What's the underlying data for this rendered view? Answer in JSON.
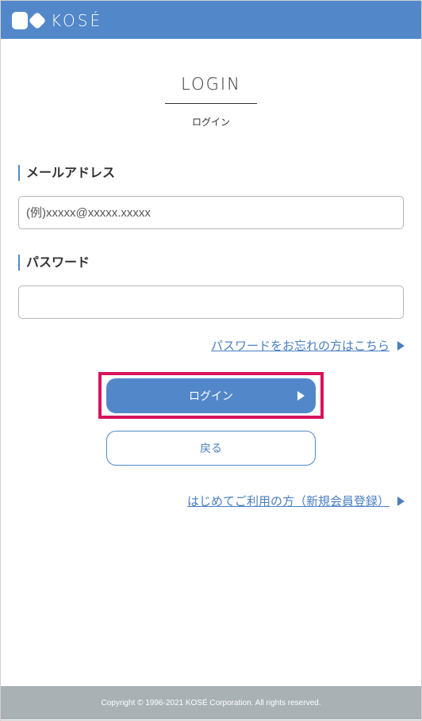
{
  "header": {
    "logo_text": "KOSÉ",
    "logo_mark_icon": "kose-logo-mark-icon",
    "bg_color": "#5288c9"
  },
  "page": {
    "title": "LOGIN",
    "subtitle": "ログイン"
  },
  "form": {
    "email_label": "メールアドレス",
    "email_placeholder": "(例)xxxxx@xxxxx.xxxxx",
    "email_value": "",
    "password_label": "パスワード",
    "password_value": ""
  },
  "links": {
    "forgot_password": "パスワードをお忘れの方はこちら",
    "register": "はじめてご利用の方（新規会員登録）"
  },
  "buttons": {
    "login_label": "ログイン",
    "back_label": "戻る"
  },
  "footer": {
    "copyright": "Copyright © 1996-2021 KOSÉ Corporation. All rights reserved."
  },
  "colors": {
    "accent": "#5288c9",
    "link": "#4a7fc0",
    "highlight": "#d8145a",
    "footer_bg": "#a9b1b5"
  }
}
